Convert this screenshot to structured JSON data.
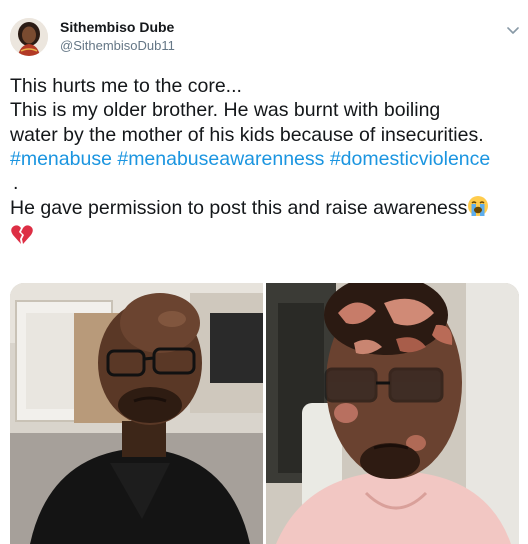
{
  "user": {
    "display_name": "Sithembiso Dube",
    "handle": "@SithembisoDub11",
    "avatar_icon": "profile-photo",
    "menu_icon": "chevron-down-icon"
  },
  "tweet": {
    "line1": "This hurts me to the core...",
    "line2": "This is my older brother. He was burnt with boiling",
    "line3": "water by the mother of his kids because of insecurities.",
    "hashtags": [
      "#menabuse",
      "#menabuseawarenness",
      "#domesticviolence"
    ],
    "dot_line": ".",
    "line5": "He gave permission to post this and raise awareness",
    "emoji_crying": "loudly-crying-face-emoji",
    "emoji_broken_heart": "broken-heart-emoji"
  },
  "media": {
    "photo_left": "photo-man-before",
    "photo_right": "photo-man-burnt"
  },
  "colors": {
    "link": "#1b95e0",
    "text": "#14171a",
    "secondary": "#657786"
  }
}
